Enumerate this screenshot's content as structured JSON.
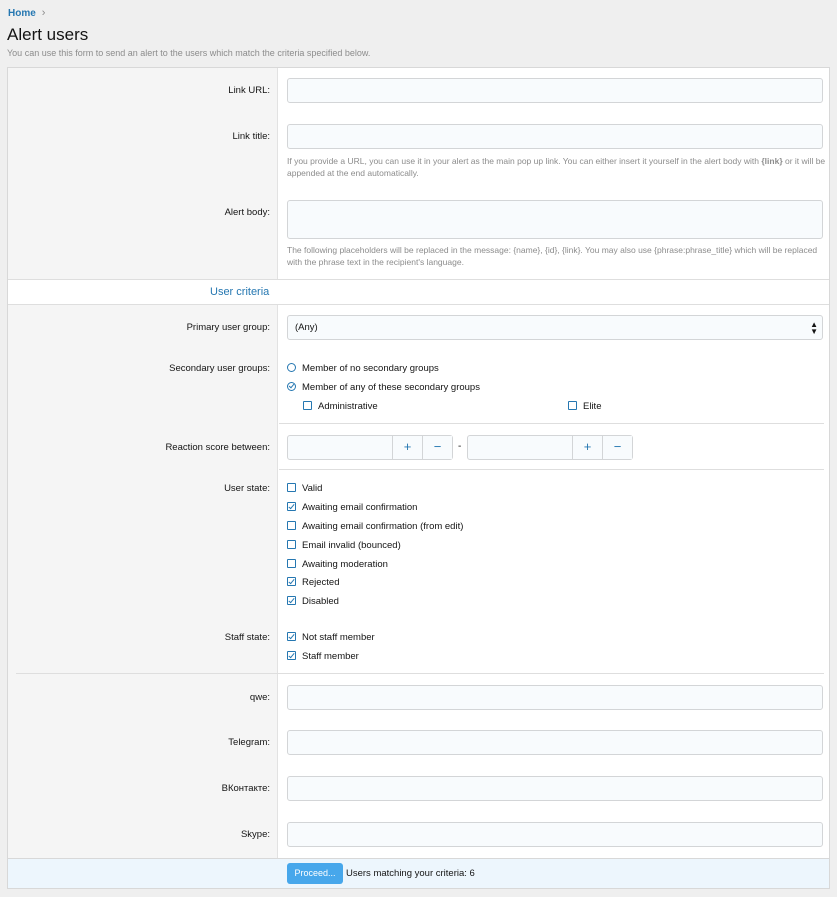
{
  "breadcrumb": {
    "home": "Home",
    "chevron": "›"
  },
  "page": {
    "title": "Alert users",
    "description": "You can use this form to send an alert to the users which match the criteria specified below."
  },
  "alert_form": {
    "link_url_label": "Link URL:",
    "link_url_value": "",
    "link_title_label": "Link title:",
    "link_title_value": "",
    "link_hint_pre": "If you provide a URL, you can use it in your alert as the main pop up link. You can either insert it yourself in the alert body with ",
    "link_hint_token": "{link}",
    "link_hint_post": " or it will be appended at the end automatically.",
    "alert_body_label": "Alert body:",
    "alert_body_value": "",
    "body_hint": "The following placeholders will be replaced in the message: {name}, {id}, {link}. You may also use {phrase:phrase_title} which will be replaced with the phrase text in the recipient's language."
  },
  "criteria": {
    "section_title": "User criteria",
    "primary_group_label": "Primary user group:",
    "primary_group_value": "(Any)",
    "secondary_groups_label": "Secondary user groups:",
    "secondary_option_none": "Member of no secondary groups",
    "secondary_option_any": "Member of any of these secondary groups",
    "secondary_groups": [
      "Administrative",
      "Elite"
    ],
    "reaction_label": "Reaction score between:",
    "reaction_min": "",
    "reaction_max": "",
    "reaction_separator": "-",
    "plus": "+",
    "minus": "−",
    "user_state_label": "User state:",
    "user_states": [
      {
        "label": "Valid",
        "checked": false
      },
      {
        "label": "Awaiting email confirmation",
        "checked": true
      },
      {
        "label": "Awaiting email confirmation (from edit)",
        "checked": false
      },
      {
        "label": "Email invalid (bounced)",
        "checked": false
      },
      {
        "label": "Awaiting moderation",
        "checked": false
      },
      {
        "label": "Rejected",
        "checked": true
      },
      {
        "label": "Disabled",
        "checked": true
      }
    ],
    "staff_state_label": "Staff state:",
    "staff_states": [
      {
        "label": "Not staff member",
        "checked": true
      },
      {
        "label": "Staff member",
        "checked": true
      }
    ]
  },
  "custom_fields": [
    {
      "label": "qwe:",
      "value": ""
    },
    {
      "label": "Telegram:",
      "value": ""
    },
    {
      "label": "ВКонтакте:",
      "value": ""
    },
    {
      "label": "Skype:",
      "value": ""
    }
  ],
  "footer": {
    "proceed_label": "Proceed...",
    "match_text": "Users matching your criteria: 6"
  },
  "colors": {
    "accent": "#2577b1",
    "button": "#47a7eb",
    "footer_bg": "#edf6fd"
  }
}
